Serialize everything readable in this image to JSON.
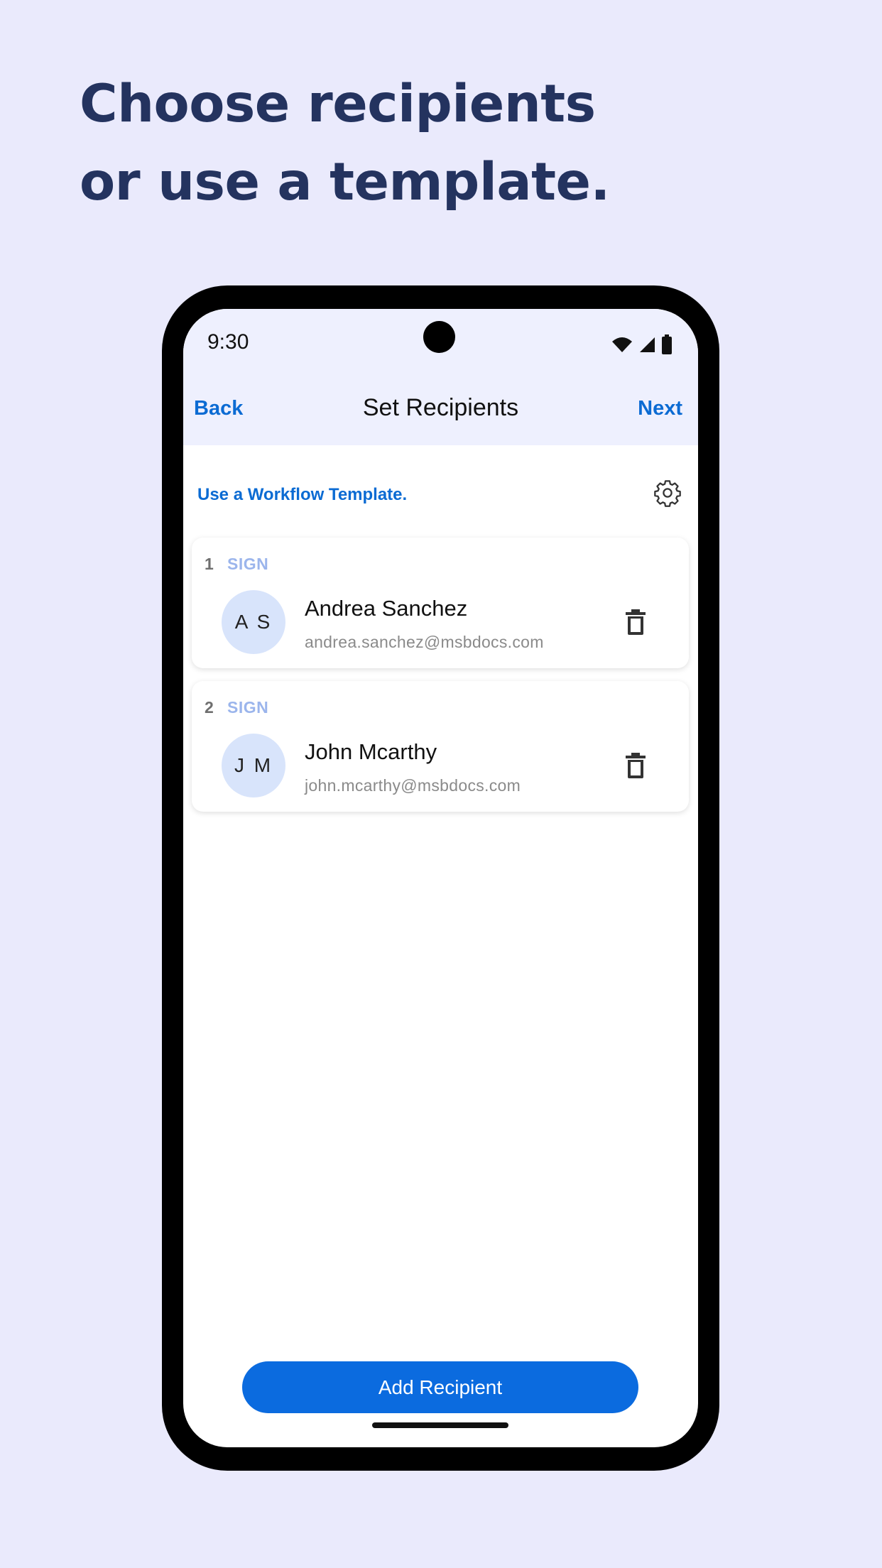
{
  "headline": {
    "line1": "Choose recipients",
    "line2": "or use a template."
  },
  "status_bar": {
    "time": "9:30"
  },
  "nav": {
    "back_label": "Back",
    "title": "Set Recipients",
    "next_label": "Next"
  },
  "template": {
    "link_label": "Use a Workflow Template."
  },
  "recipients": [
    {
      "order": "1",
      "role": "SIGN",
      "initials": "A S",
      "name": "Andrea Sanchez",
      "email": "andrea.sanchez@msbdocs.com"
    },
    {
      "order": "2",
      "role": "SIGN",
      "initials": "J M",
      "name": "John Mcarthy",
      "email": "john.mcarthy@msbdocs.com"
    }
  ],
  "actions": {
    "add_label": "Add Recipient"
  },
  "colors": {
    "background": "#EAEAFC",
    "headline": "#24335F",
    "accent": "#0B6BD3",
    "button": "#0B6BDF",
    "role": "#9BB5EC",
    "avatar": "#D8E4FB"
  }
}
